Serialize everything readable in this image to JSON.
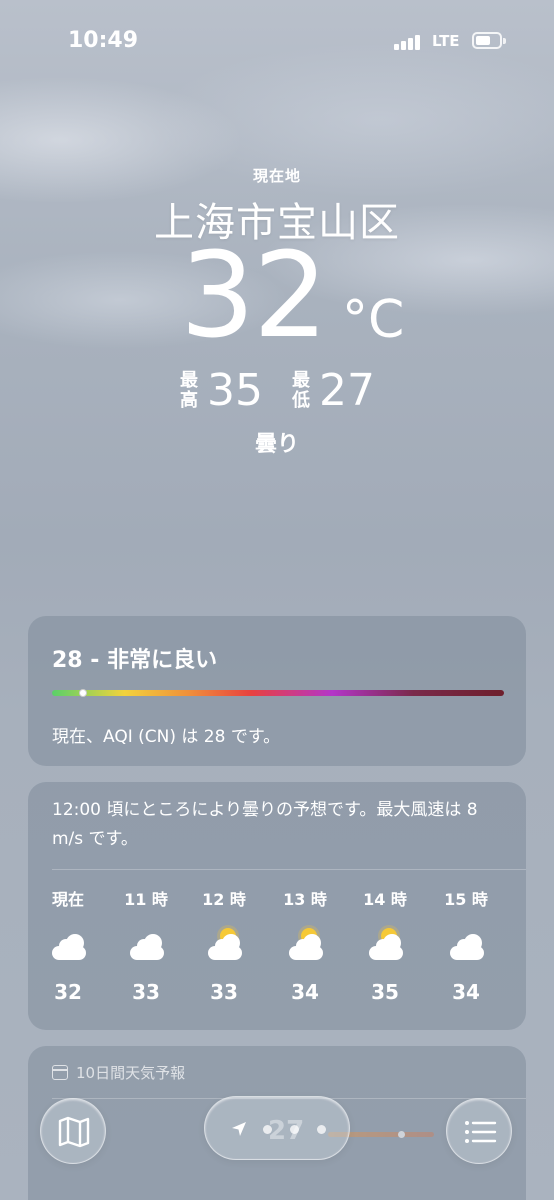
{
  "status": {
    "time": "10:49",
    "network": "LTE"
  },
  "hero": {
    "location_label": "現在地",
    "city": "上海市宝山区",
    "temp": "32",
    "unit": "°C",
    "high_label": "最高",
    "high": "35",
    "low_label": "最低",
    "low": "27",
    "condition": "曇り"
  },
  "aqi": {
    "title": "28 - 非常に良い",
    "value": 28,
    "level_fraction": 0.06,
    "description": "現在、AQI (CN) は 28 です。"
  },
  "hourly": {
    "summary": "12:00 頃にところにより曇りの予想です。最大風速は 8 m/s です。",
    "items": [
      {
        "label": "現在",
        "icon": "cloud-icon",
        "temp": "32"
      },
      {
        "label": "11 時",
        "icon": "cloud-icon",
        "temp": "33"
      },
      {
        "label": "12 時",
        "icon": "partly-sunny-icon",
        "temp": "33"
      },
      {
        "label": "13 時",
        "icon": "partly-sunny-icon",
        "temp": "34"
      },
      {
        "label": "14 時",
        "icon": "partly-sunny-icon",
        "temp": "35"
      },
      {
        "label": "15 時",
        "icon": "cloud-icon",
        "temp": "34"
      }
    ]
  },
  "daily": {
    "header": "10日間天気予報",
    "first_low": "27"
  },
  "toolbar": {
    "map_icon": "map-icon",
    "location_icon": "location-arrow-icon",
    "list_icon": "list-icon",
    "page_count": 4
  },
  "colors": {
    "aqi_green": "#5ad06a",
    "aqi_purple": "#b336c8",
    "aqi_maroon": "#6e1f2c",
    "sun": "#f6c936"
  }
}
